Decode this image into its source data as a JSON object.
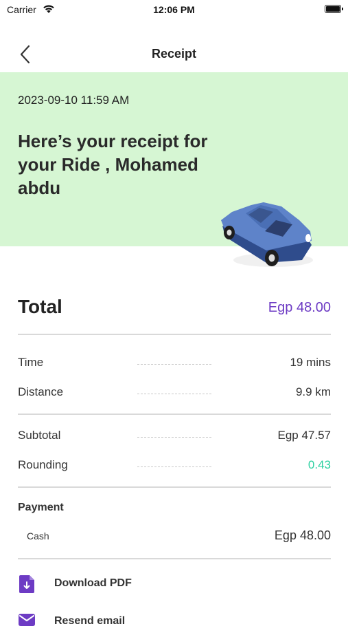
{
  "status_bar": {
    "carrier": "Carrier",
    "time": "12:06 PM"
  },
  "nav": {
    "title": "Receipt"
  },
  "hero": {
    "date": "2023-09-10 11:59 AM",
    "title": "Here’s your receipt for your Ride , Mohamed abdu",
    "bg_color": "#d6f6d3"
  },
  "total": {
    "label": "Total",
    "value": "Egp 48.00",
    "value_color": "#6d3bc4"
  },
  "trip": {
    "time_label": "Time",
    "time_value": "19 mins",
    "distance_label": "Distance",
    "distance_value": "9.9 km"
  },
  "fare": {
    "subtotal_label": "Subtotal",
    "subtotal_value": "Egp 47.57",
    "rounding_label": "Rounding",
    "rounding_value": "0.43",
    "rounding_color": "#2bd0a0"
  },
  "payment": {
    "title": "Payment",
    "method": "Cash",
    "amount": "Egp 48.00"
  },
  "actions": [
    {
      "label": "Download PDF",
      "icon": "pdf-file-icon"
    },
    {
      "label": "Resend email",
      "icon": "email-icon"
    }
  ],
  "accent_color": "#6d3bc4"
}
